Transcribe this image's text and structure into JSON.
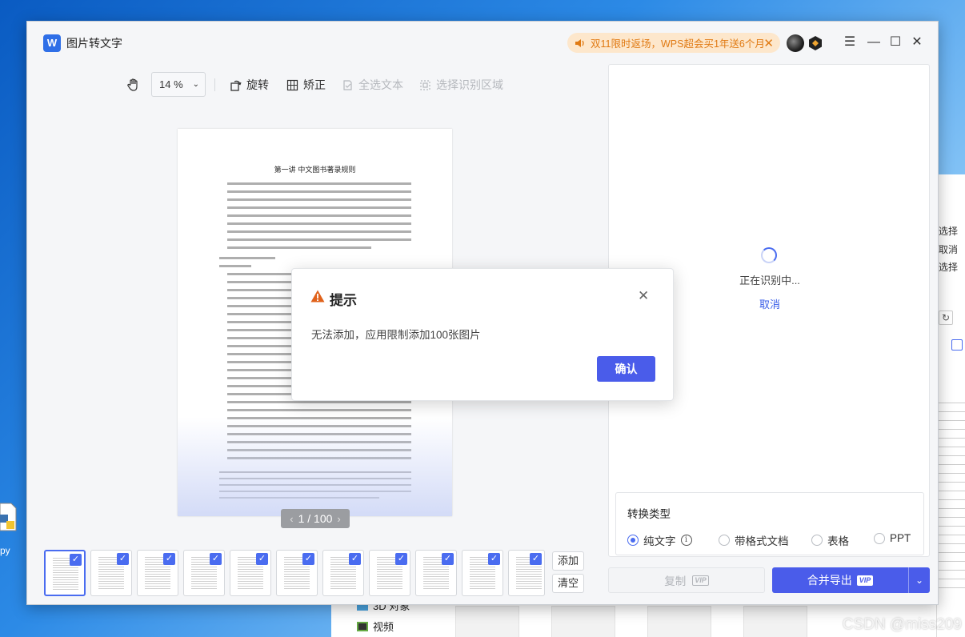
{
  "app": {
    "title": "图片转文字",
    "logo_letter": "W",
    "promo_text": "双11限时返场，WPS超会买1年送6个月"
  },
  "toolbar": {
    "zoom_value": "14 %",
    "rotate_label": "旋转",
    "correct_label": "矫正",
    "select_all_label": "全选文本",
    "select_region_label": "选择识别区域"
  },
  "document": {
    "page_title": "第一讲   中文图书著录规则"
  },
  "pager": {
    "text": "1 / 100"
  },
  "thumbs": {
    "count": 11,
    "add_label": "添加",
    "clear_label": "清空",
    "check_mark": "✓"
  },
  "right_panel": {
    "status": "正在识别中...",
    "cancel": "取消"
  },
  "convert": {
    "title": "转换类型",
    "options": [
      {
        "label": "纯文字",
        "selected": true
      },
      {
        "label": "带格式文档",
        "selected": false
      },
      {
        "label": "表格",
        "selected": false
      },
      {
        "label": "PPT",
        "selected": false
      }
    ]
  },
  "actions": {
    "copy_label": "复制",
    "export_label": "合并导出",
    "vip_badge": "VIP"
  },
  "modal": {
    "title": "提示",
    "message": "无法添加，应用限制添加100张图片",
    "confirm": "确认"
  },
  "background": {
    "right_window_lines": [
      "选择",
      "取消",
      "选择"
    ],
    "explorer_items": [
      "3D 对象",
      "视频"
    ],
    "desktop_icon_label": "py",
    "watermark": "CSDN @miss209"
  },
  "colors": {
    "accent": "#4a5cea",
    "promo_bg": "#fde7cc",
    "promo_text": "#e07a13",
    "warning": "#e0621b"
  }
}
